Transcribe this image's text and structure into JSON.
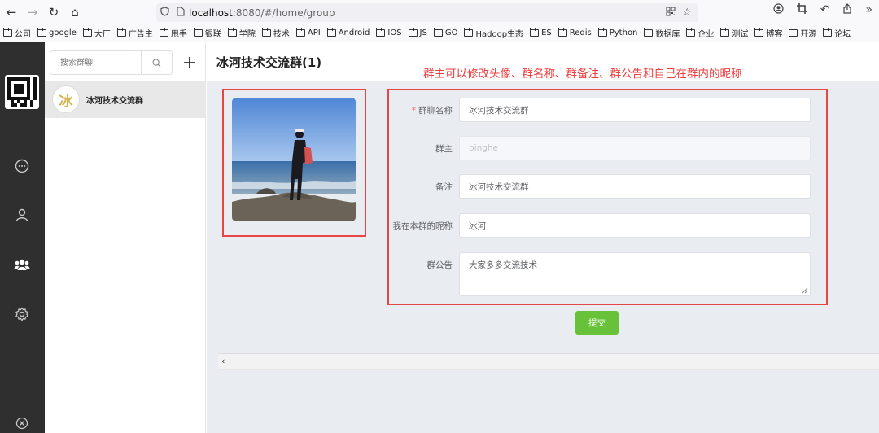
{
  "browser": {
    "url_host": "localhost",
    "url_path": ":8080/#/home/group",
    "nav": {
      "back": "←",
      "forward": "→",
      "reload": "↻",
      "home": "⌂"
    },
    "bookmarks": [
      "公司",
      "google",
      "大厂",
      "广告主",
      "甩手",
      "银联",
      "学院",
      "技术",
      "API",
      "Android",
      "IOS",
      "JS",
      "GO",
      "Hadoop生态",
      "ES",
      "Redis",
      "Python",
      "数据库",
      "企业",
      "测试",
      "博客",
      "开源",
      "论坛"
    ]
  },
  "sidebar": {
    "search_placeholder": "搜索群聊",
    "add_label": "+",
    "groups": [
      {
        "avatar_char": "冰",
        "name": "冰河技术交流群"
      }
    ]
  },
  "main": {
    "title": "冰河技术交流群(1)",
    "annotation": "群主可以修改头像、群名称、群备注、群公告和自己在群内的昵称",
    "form": {
      "name_label": "群聊名称",
      "name_value": "冰河技术交流群",
      "owner_label": "群主",
      "owner_value": "binghe",
      "remark_label": "备注",
      "remark_value": "冰河技术交流群",
      "nickname_label": "我在本群的昵称",
      "nickname_value": "冰河",
      "notice_label": "群公告",
      "notice_value": "大家多多交流技术"
    },
    "submit_label": "提交",
    "scroll_arrow": "‹"
  },
  "colors": {
    "rail": "#2f2f2f",
    "accent_green": "#67c23a",
    "annotation_red": "#ef3e3e",
    "main_bg": "#e9edf1"
  },
  "icons": [
    "back-icon",
    "forward-icon",
    "reload-icon",
    "home-icon",
    "shield-icon",
    "page-icon",
    "qr-icon",
    "star-icon",
    "account-icon",
    "crop-icon",
    "undo-icon",
    "share-icon",
    "more-icon",
    "folder-icon",
    "chat-icon",
    "user-icon",
    "group-icon",
    "settings-icon",
    "close-circle-icon",
    "search-icon",
    "plus-icon"
  ]
}
